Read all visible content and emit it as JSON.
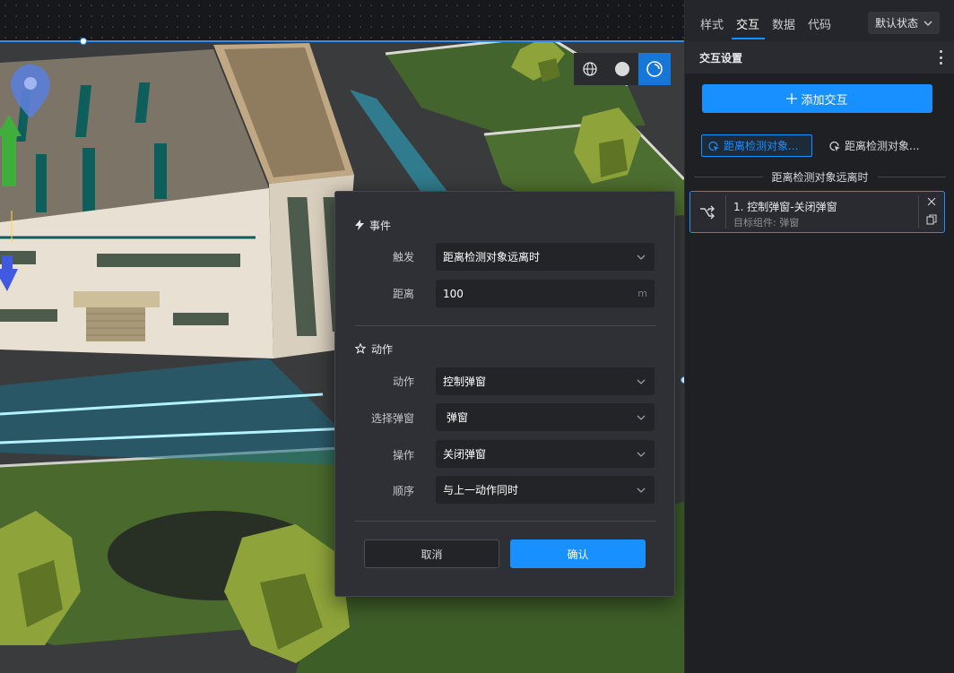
{
  "viewport": {
    "toolbar": [
      {
        "name": "globe-icon",
        "active": false
      },
      {
        "name": "sphere-icon",
        "active": false
      },
      {
        "name": "orbit-icon",
        "active": true
      }
    ]
  },
  "modal": {
    "event_section": {
      "title": "事件",
      "trigger_label": "触发",
      "trigger_value": "距离检测对象远离时",
      "distance_label": "距离",
      "distance_value": "100",
      "distance_unit": "m"
    },
    "action_section": {
      "title": "动作",
      "action_label": "动作",
      "action_value": "控制弹窗",
      "popup_label": "选择弹窗",
      "popup_value": "弹窗",
      "operation_label": "操作",
      "operation_value": "关闭弹窗",
      "order_label": "顺序",
      "order_value": "与上一动作同时"
    },
    "cancel_label": "取消",
    "confirm_label": "确认"
  },
  "panel": {
    "tabs": [
      {
        "label": "样式"
      },
      {
        "label": "交互"
      },
      {
        "label": "数据"
      },
      {
        "label": "代码"
      }
    ],
    "active_tab": "交互",
    "state_select": "默认状态",
    "section_title": "交互设置",
    "add_button": "添加交互",
    "chips": [
      {
        "label": "距离检测对象..."
      },
      {
        "label": "距离检测对象..."
      }
    ],
    "group_label": "距离检测对象远离时",
    "action_card": {
      "title": "1. 控制弹窗-关闭弹窗",
      "subtitle": "目标组件: 弹窗"
    },
    "colors": {
      "accent": "#1890ff",
      "panel_bg": "#1f2024",
      "modal_bg": "#2f3035"
    }
  }
}
